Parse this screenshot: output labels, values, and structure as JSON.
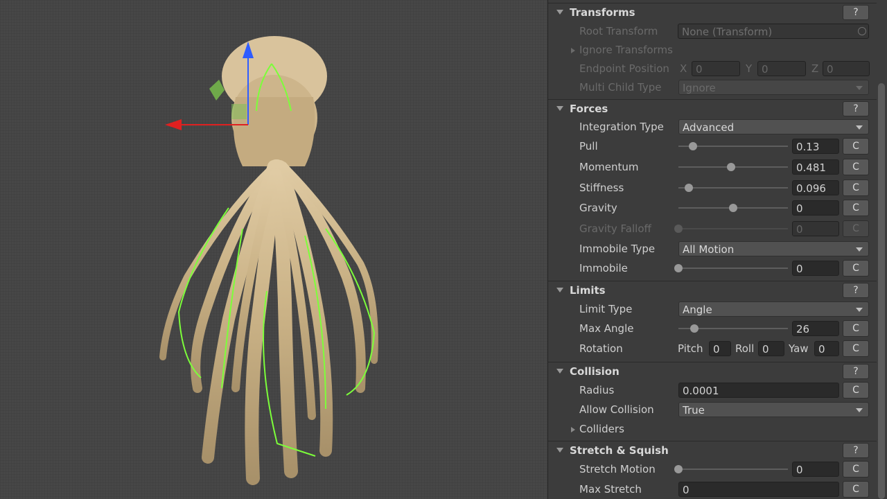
{
  "colors": {
    "viewport_bg": "#474747",
    "inspector_bg": "#3c3c3c",
    "gizmo_y": "#2f5cff",
    "gizmo_x": "#e02020",
    "bone_lines": "#7cff3a",
    "hair": "#cdb58b"
  },
  "transforms": {
    "title": "Transforms",
    "help": "?",
    "root_transform_label": "Root Transform",
    "root_transform_value": "None (Transform)",
    "ignore_transforms_label": "Ignore Transforms",
    "endpoint_label": "Endpoint Position",
    "endpoint_x_axis": "X",
    "endpoint_x": "0",
    "endpoint_y_axis": "Y",
    "endpoint_y": "0",
    "endpoint_z_axis": "Z",
    "endpoint_z": "0",
    "multi_child_label": "Multi Child Type",
    "multi_child_value": "Ignore"
  },
  "forces": {
    "title": "Forces",
    "help": "?",
    "integration_label": "Integration Type",
    "integration_value": "Advanced",
    "pull_label": "Pull",
    "pull_value": "0.13",
    "pull_fraction": 0.13,
    "momentum_label": "Momentum",
    "momentum_value": "0.481",
    "momentum_fraction": 0.481,
    "stiffness_label": "Stiffness",
    "stiffness_value": "0.096",
    "stiffness_fraction": 0.096,
    "gravity_label": "Gravity",
    "gravity_value": "0",
    "gravity_fraction": 0.5,
    "gravity_falloff_label": "Gravity Falloff",
    "gravity_falloff_value": "0",
    "gravity_falloff_fraction": 0,
    "immobile_type_label": "Immobile Type",
    "immobile_type_value": "All Motion",
    "immobile_label": "Immobile",
    "immobile_value": "0",
    "immobile_fraction": 0,
    "c_label": "C"
  },
  "limits": {
    "title": "Limits",
    "help": "?",
    "limit_type_label": "Limit Type",
    "limit_type_value": "Angle",
    "max_angle_label": "Max Angle",
    "max_angle_value": "26",
    "max_angle_fraction": 0.144,
    "rotation_label": "Rotation",
    "pitch_label": "Pitch",
    "pitch_value": "0",
    "roll_label": "Roll",
    "roll_value": "0",
    "yaw_label": "Yaw",
    "yaw_value": "0",
    "c_label": "C"
  },
  "collision": {
    "title": "Collision",
    "help": "?",
    "radius_label": "Radius",
    "radius_value": "0.0001",
    "allow_label": "Allow Collision",
    "allow_value": "True",
    "colliders_label": "Colliders",
    "c_label": "C"
  },
  "stretch": {
    "title": "Stretch & Squish",
    "help": "?",
    "stretch_motion_label": "Stretch Motion",
    "stretch_motion_value": "0",
    "stretch_motion_fraction": 0,
    "max_stretch_label": "Max Stretch",
    "max_stretch_value": "0",
    "c_label": "C"
  }
}
